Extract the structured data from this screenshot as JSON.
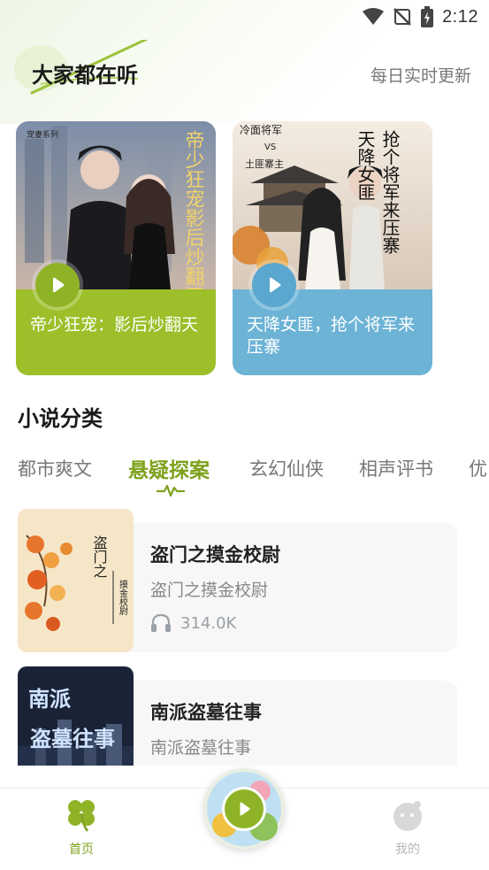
{
  "status_bar": {
    "time": "2:12"
  },
  "header": {
    "title": "大家都在听",
    "subtitle": "每日实时更新"
  },
  "featured": [
    {
      "title": "帝少狂宠：影后炒翻天",
      "cover_text": "帝少狂宠影后炒翻天",
      "tag": "宠妻系列",
      "band_color": "#9cbf2a"
    },
    {
      "title": "天降女匪，抢个将军来压寨",
      "cover_text_a": "天降女匪",
      "cover_text_b": "抢个将军来压寨",
      "cover_top": "冷面将军",
      "cover_vs": "VS",
      "cover_sub": "土匪寨主",
      "band_color": "#6cb3d6"
    }
  ],
  "categories": {
    "title": "小说分类",
    "tabs": [
      "都市爽文",
      "悬疑探案",
      "玄幻仙侠",
      "相声评书",
      "优"
    ],
    "active_index": 1,
    "accent": "#7ea11d"
  },
  "books": [
    {
      "title": "盗门之摸金校尉",
      "subtitle": "盗门之摸金校尉",
      "plays": "314.0K",
      "cover_title": "盗门之",
      "cover_sub": "摸金校尉"
    },
    {
      "title": "南派盗墓往事",
      "subtitle": "南派盗墓往事",
      "cover_title_a": "南派",
      "cover_title_b": "盗墓往事"
    }
  ],
  "bottom_nav": {
    "home_label": "首页",
    "mine_label": "我的"
  }
}
